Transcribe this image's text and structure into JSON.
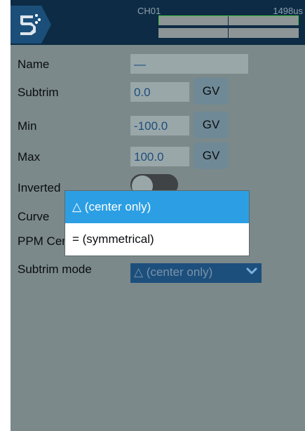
{
  "header": {
    "channel": "CH01",
    "value_us": "1498us"
  },
  "form": {
    "name": {
      "label": "Name",
      "value": "—"
    },
    "subtrim": {
      "label": "Subtrim",
      "value": "0.0",
      "gv": "GV"
    },
    "min": {
      "label": "Min",
      "value": "-100.0",
      "gv": "GV"
    },
    "max": {
      "label": "Max",
      "value": "100.0",
      "gv": "GV"
    },
    "inverted": {
      "label": "Inverted",
      "on": false
    },
    "curve": {
      "label": "Curve"
    },
    "ppm_center": {
      "label": "PPM Center"
    },
    "subtrim_mode": {
      "label": "Subtrim mode",
      "value": "△ (center only)"
    }
  },
  "popup": {
    "options": [
      {
        "label": "△ (center only)",
        "selected": true
      },
      {
        "label": "= (symmetrical)",
        "selected": false
      }
    ]
  },
  "colors": {
    "screen_bg": "#7b898a",
    "header_bg": "#0d2b44",
    "accent": "#1d4f7d",
    "highlight": "#2c9fe4"
  }
}
